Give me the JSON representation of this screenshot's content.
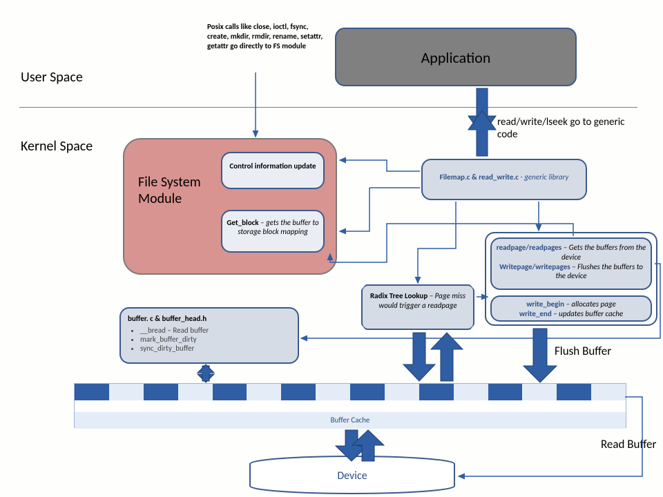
{
  "labels": {
    "user_space": "User Space",
    "kernel_space": "Kernel Space",
    "posix_note": "Posix calls like close, ioctl, fsync, create, mkdir, rmdir, rename, setattr, getattr go directly to FS module",
    "application": "Application",
    "rw_note": "read/write/lseek go to generic code",
    "filemap_a": "Filemap.c & read_write.c",
    "filemap_b": " - generic library",
    "fs_module": "File System Module",
    "ctrl_info": "Control information update",
    "getblock_a": "Get_block",
    "getblock_b": " – gets the buffer to storage block mapping",
    "readpage_a": "readpage/readpages",
    "readpage_b": " – Gets the buffers from the device",
    "writepage_a": "Writepage/writepages",
    "writepage_b": " – Flushes the buffers to the device",
    "writebegin_a": "write_begin",
    "writebegin_b": " – allocates page",
    "writeend_a": "write_end",
    "writeend_b": " – updates buffer cache",
    "radix_a": "Radix Tree Lookup",
    "radix_b": " – Page miss would trigger a readpage",
    "buffer_hdr_a": "buffer. c & buffer_head.h",
    "buffer_li1": "__bread – Read buffer",
    "buffer_li2": "mark_buffer_dirty",
    "buffer_li3": "sync_dirty_buffer",
    "buffer_cache": "Buffer Cache",
    "device": "Device",
    "flush_buffer": "Flush Buffer",
    "read_buffer": "Read Buffer"
  }
}
